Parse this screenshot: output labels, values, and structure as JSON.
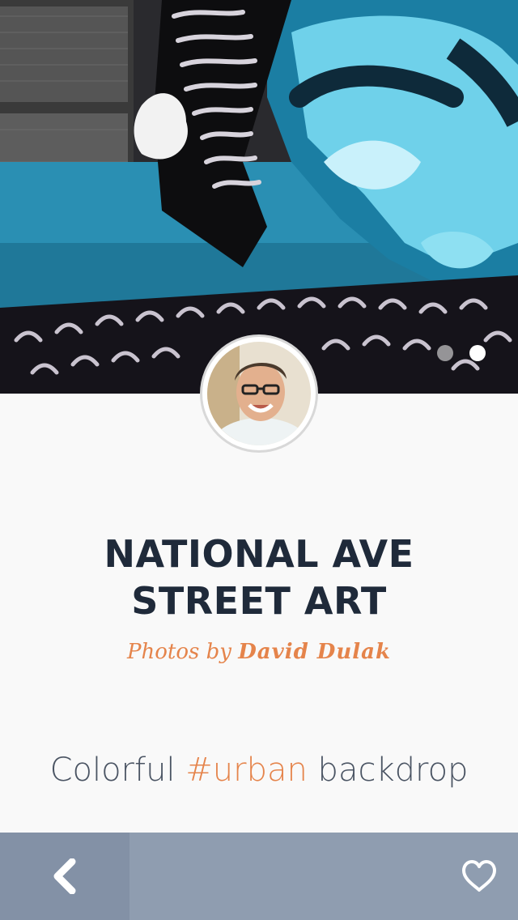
{
  "post": {
    "title_line1": "NATIONAL AVE",
    "title_line2": "STREET ART",
    "byline_prefix": "Photos by",
    "author": "David Dulak"
  },
  "caption": {
    "before": "Colorful ",
    "hashtag": "#urban",
    "after": " backdrop"
  },
  "carousel": {
    "page_count": 2,
    "active_page": 2
  },
  "toolbar": {
    "back_icon": "chevron-left-icon",
    "favorite_icon": "heart-outline-icon"
  },
  "colors": {
    "accent": "#e5844b",
    "title": "#1f2a3a",
    "toolbar": "#8f9db0",
    "toolbar_back": "#8391a6"
  }
}
